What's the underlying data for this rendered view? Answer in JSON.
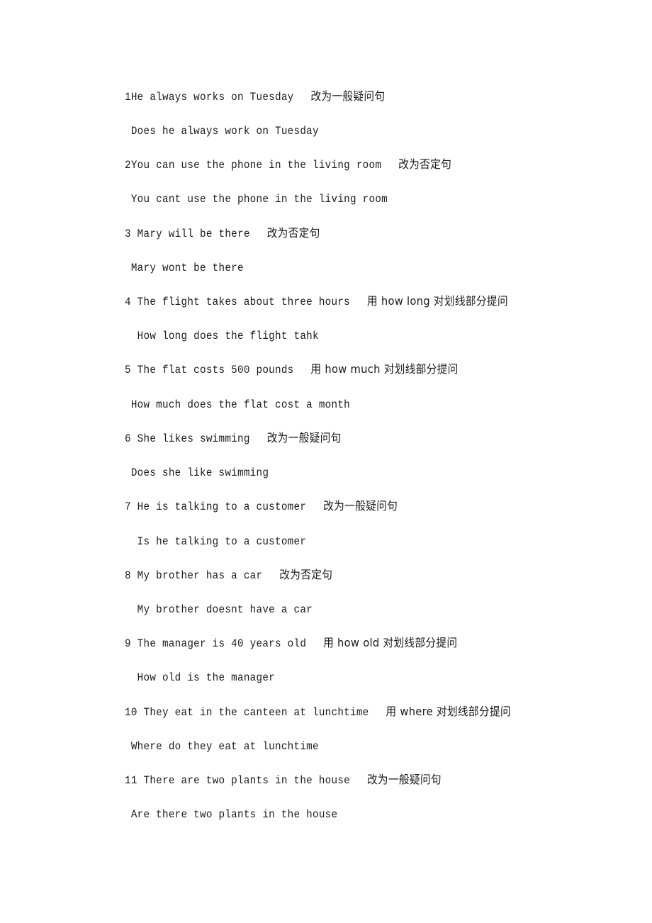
{
  "document": {
    "items": [
      {
        "number": "1",
        "question": "1He always works on Tuesday",
        "instruction": "改为一般疑问句",
        "answer": " Does he always work on Tuesday"
      },
      {
        "number": "2",
        "question": "2You can use the phone in the living room",
        "instruction": "改为否定句",
        "answer": " You cant use the phone in the living room"
      },
      {
        "number": "3",
        "question": "3 Mary will be there",
        "instruction": "改为否定句",
        "answer": " Mary wont be there"
      },
      {
        "number": "4",
        "question": "4 The flight takes about three hours",
        "instruction": "用 how long 对划线部分提问",
        "answer": "  How long does the flight tahk"
      },
      {
        "number": "5",
        "question": "5 The flat costs 500 pounds",
        "instruction": "用 how much 对划线部分提问",
        "answer": " How much does the flat cost a month"
      },
      {
        "number": "6",
        "question": "6 She likes swimming",
        "instruction": "改为一般疑问句",
        "answer": " Does she like swimming"
      },
      {
        "number": "7",
        "question": "7 He is talking to a customer",
        "instruction": "改为一般疑问句",
        "answer": "  Is he talking to a customer"
      },
      {
        "number": "8",
        "question": "8 My brother has a car",
        "instruction": "改为否定句",
        "answer": "  My brother doesnt have a car"
      },
      {
        "number": "9",
        "question": "9 The manager is 40 years old",
        "instruction": "用 how old 对划线部分提问",
        "answer": "  How old is the manager"
      },
      {
        "number": "10",
        "question": "10 They eat in the canteen at lunchtime",
        "instruction": "用 where 对划线部分提问",
        "answer": " Where do they eat at lunchtime"
      },
      {
        "number": "11",
        "question": "11 There are two plants in the house",
        "instruction": "改为一般疑问句",
        "answer": " Are there two plants in the house"
      }
    ]
  }
}
